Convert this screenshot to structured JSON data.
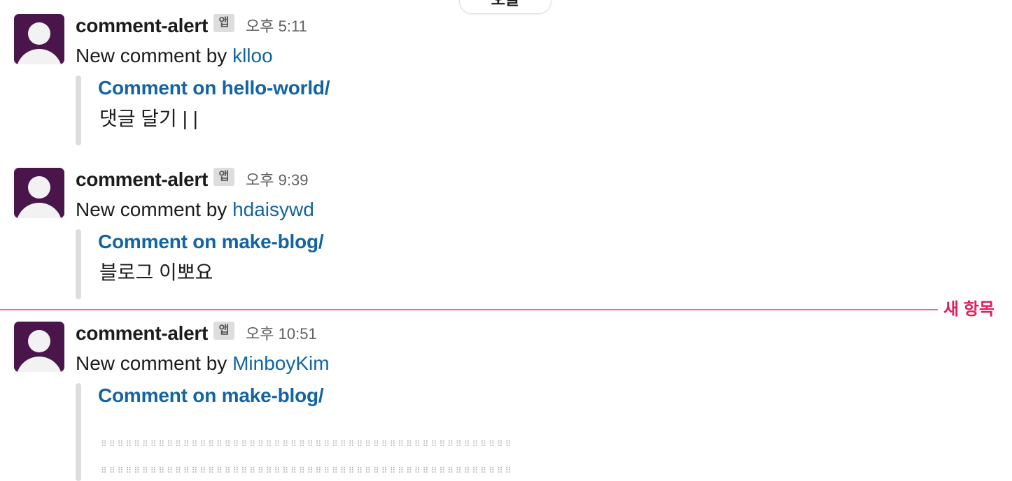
{
  "date_divider": {
    "label": "오늘"
  },
  "new_divider": {
    "label": "새 항목",
    "color": "#e01e5a"
  },
  "messages": [
    {
      "sender": "comment-alert",
      "badge": "앱",
      "time": "오후 5:11",
      "text_prefix": "New comment by",
      "author": "klloo",
      "attachment": {
        "title": "Comment on hello-world/",
        "body": "댓글 달기 | |"
      }
    },
    {
      "sender": "comment-alert",
      "badge": "앱",
      "time": "오후 9:39",
      "text_prefix": "New comment by",
      "author": "hdaisywd",
      "attachment": {
        "title": "Comment on make-blog/",
        "body": "블로그 이뽀요"
      }
    },
    {
      "sender": "comment-alert",
      "badge": "앱",
      "time": "오후 10:51",
      "text_prefix": "New comment by",
      "author": "MinboyKim",
      "attachment": {
        "title": "Comment on make-blog/",
        "body_rows": [
          "⠿⠿⠿⠿⠿⠿⠿⠿⠿⠿⠿⠿⠿⠿⠿⠿⠿⠿⠿⠿⠿⠿⠿⠿⠿⠿⠿⠿⠿⠿⠿⠿⠿⠿⠿⠿⠿⠿⠿⠿⠿⠿⠿⠿⠿⠿⠿⠿⠿⠿",
          "⠿⠿⠿⠿⠿⠿⠿⠿⠿⠿⠿⠿⠿⠿⠿⠿⠿⠿⠿⠿⠿⠿⠿⠿⠿⠿⠿⠿⠿⠿⠿⠿⠿⠿⠿⠿⠿⠿⠿⠿⠿⠿⠿⠿⠿⠿⠿⠿⠿⠿"
        ]
      }
    }
  ],
  "colors": {
    "avatar_bg": "#4a154b",
    "link": "#1264a3",
    "quote_bar": "#dddddd",
    "divider_line": "#e8739a"
  }
}
